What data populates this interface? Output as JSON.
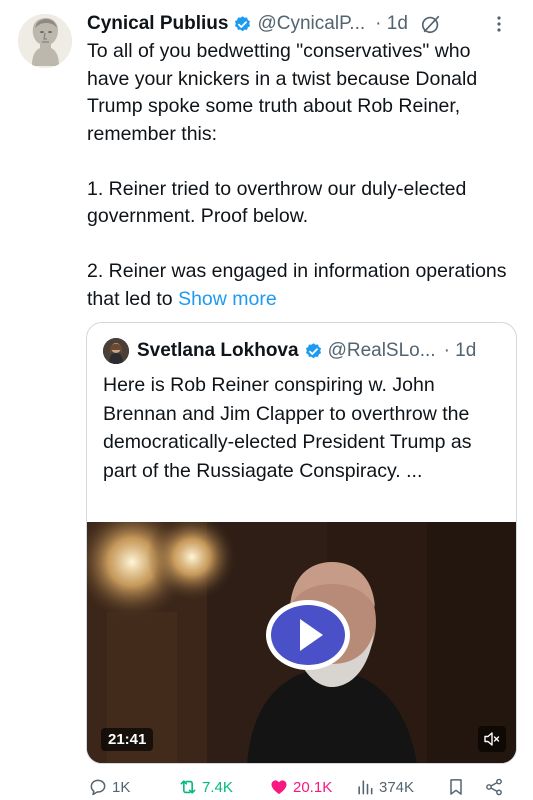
{
  "tweet": {
    "author_name": "Cynical Publius",
    "author_handle": "@CynicalP...",
    "time": "· 1d",
    "lines": [
      "To all of you bedwetting \"conservatives\" who have your knickers in a twist because Donald Trump spoke some truth about Rob Reiner, remember this:",
      "1. Reiner tried to overthrow our duly-elected government.  Proof below.",
      "2. Reiner was engaged in information operations that led to"
    ],
    "show_more": "Show more"
  },
  "quote": {
    "author_name": "Svetlana Lokhova",
    "author_handle": "@RealSLo...",
    "time": "· 1d",
    "text": "Here is Rob Reiner conspiring w. John Brennan and Jim Clapper to overthrow the democratically-elected President Trump as part of the Russiagate Conspiracy. ...",
    "video_duration": "21:41"
  },
  "actions": {
    "replies": "1K",
    "reposts": "7.4K",
    "likes": "20.1K",
    "views": "374K"
  },
  "colors": {
    "accent": "#1d9bf0",
    "repost": "#00ba7c",
    "like": "#f91880",
    "play": "#4a50c8"
  }
}
